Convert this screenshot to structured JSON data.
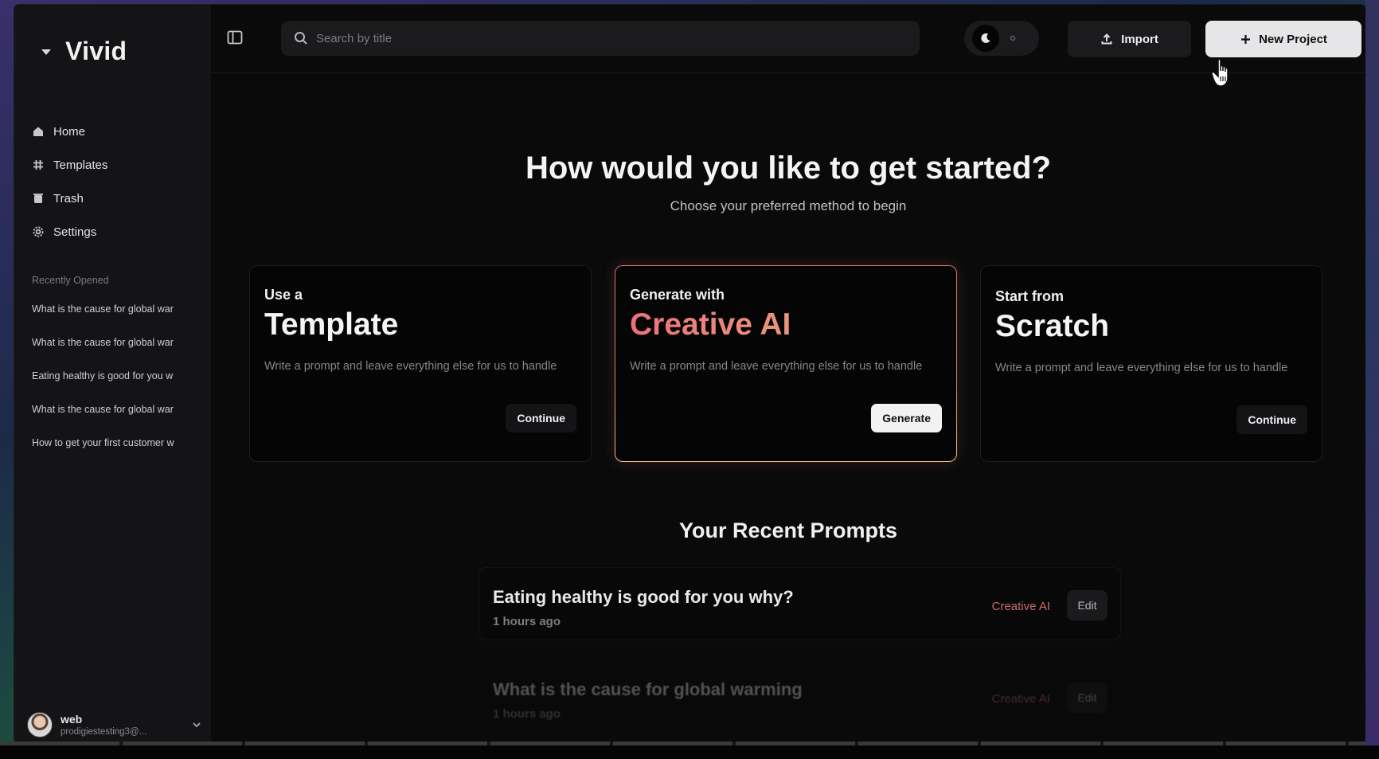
{
  "app": {
    "name": "Vivid",
    "logo_icon": "triangle-down-icon"
  },
  "sidebar": {
    "nav": [
      {
        "label": "Home",
        "icon": "home-icon"
      },
      {
        "label": "Templates",
        "icon": "grid-icon"
      },
      {
        "label": "Trash",
        "icon": "trash-icon"
      },
      {
        "label": "Settings",
        "icon": "gear-icon"
      }
    ],
    "recent_heading": "Recently Opened",
    "recent": [
      "What is the cause for global war",
      "What is the cause for global war",
      "Eating healthy is good for you w",
      "What is the cause for global war",
      "How to get your first customer w"
    ],
    "user": {
      "name": "web",
      "email": "prodigiestesting3@..."
    }
  },
  "topbar": {
    "search_placeholder": "Search by title",
    "import_label": "Import",
    "new_project_label": "New Project"
  },
  "hero": {
    "title": "How would you like to get started?",
    "subtitle": "Choose your preferred method to begin"
  },
  "cards": [
    {
      "kicker": "Use a",
      "title": "Template",
      "desc": "Write a prompt and leave everything else for us to handle",
      "button": "Continue"
    },
    {
      "kicker": "Generate with",
      "title": "Creative AI",
      "desc": "Write a prompt and leave everything else for us to handle",
      "button": "Generate"
    },
    {
      "kicker": "Start from",
      "title": "Scratch",
      "desc": "Write a prompt and leave everything else for us to handle",
      "button": "Continue"
    }
  ],
  "recent_prompts": {
    "heading": "Your Recent Prompts",
    "items": [
      {
        "title": "Eating healthy is good for you why?",
        "time": "1 hours ago",
        "tag": "Creative AI",
        "edit": "Edit"
      },
      {
        "title": "What is the cause for global warming",
        "time": "1 hours ago",
        "tag": "Creative AI",
        "edit": "Edit"
      }
    ]
  },
  "colors": {
    "accent_gradient_start": "#ef6f7c",
    "accent_gradient_end": "#e8987a",
    "background": "#0a0a0b",
    "sidebar": "#141416"
  }
}
